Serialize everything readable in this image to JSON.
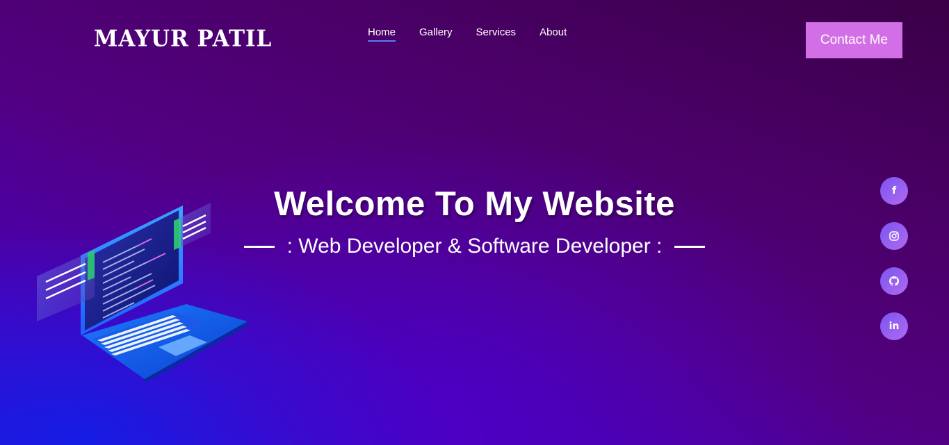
{
  "header": {
    "logo": "MAYUR PATIL",
    "nav": [
      {
        "label": "Home",
        "active": true
      },
      {
        "label": "Gallery",
        "active": false
      },
      {
        "label": "Services",
        "active": false
      },
      {
        "label": "About",
        "active": false
      }
    ],
    "contact_label": "Contact Me"
  },
  "hero": {
    "title": "Welcome To My Website",
    "subtitle": ": Web Developer & Software Developer :"
  },
  "social": [
    {
      "name": "facebook-icon",
      "glyph": "f"
    },
    {
      "name": "instagram-icon",
      "glyph": ""
    },
    {
      "name": "github-icon",
      "glyph": ""
    },
    {
      "name": "linkedin-icon",
      "glyph": "in"
    }
  ],
  "colors": {
    "accent_button": "#d36fe6",
    "nav_underline": "#5a7cff",
    "social_start": "#7a55f0",
    "social_end": "#b06af0"
  }
}
